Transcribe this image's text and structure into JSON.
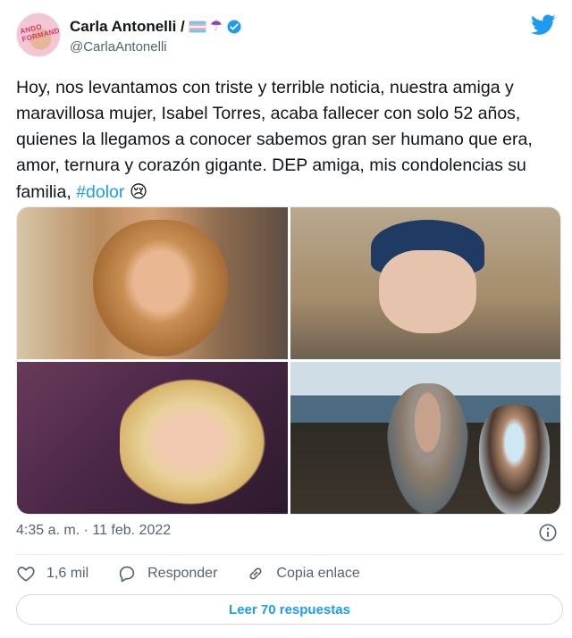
{
  "author": {
    "display_name": "Carla Antonelli /",
    "handle": "@CarlaAntonelli",
    "avatar_text": "ANDO FORMANDO",
    "name_icons": [
      "transgender-flag-icon",
      "umbrella-icon",
      "verified-icon"
    ],
    "verified_color": "#1d9bf0"
  },
  "brand": {
    "icon": "twitter-bird-icon",
    "color": "#1d9bf0"
  },
  "tweet": {
    "text": "Hoy, nos levantamos con triste y terrible noticia, nuestra amiga y maravillosa mujer, Isabel Torres, acaba fallecer con solo 52 años, quienes la llegamos a conocer sabemos gran ser humano que era, amor, ternura y corazón gigante. DEP amiga, mis condolencias su familia, ",
    "hashtag": "#dolor",
    "emoji": "😢",
    "hashtag_color": "#1d9bf0"
  },
  "media": {
    "photos": [
      "photo-woman-curly-hair",
      "photo-woman-headscarf",
      "photo-woman-blonde-night",
      "photo-selfie-coast"
    ]
  },
  "meta": {
    "timestamp": "4:35 a. m. · 11 feb. 2022"
  },
  "actions": {
    "like_count": "1,6 mil",
    "reply_label": "Responder",
    "copy_label": "Copia enlace"
  },
  "replies_button": {
    "label": "Leer 70 respuestas"
  }
}
